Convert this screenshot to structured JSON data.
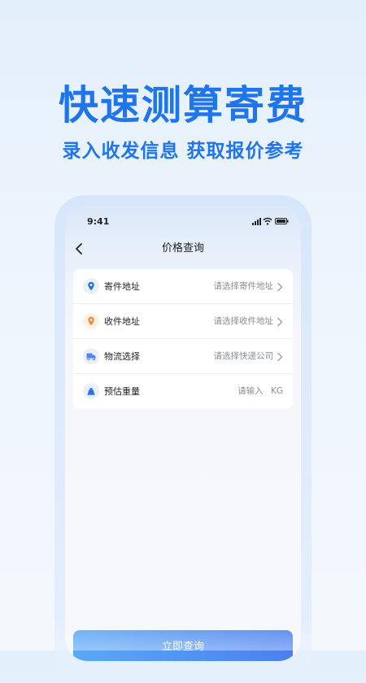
{
  "hero": {
    "title": "快速测算寄费",
    "subtitle": "录入收发信息 获取报价参考"
  },
  "status_bar": {
    "time": "9:41",
    "icons": [
      "signal-icon",
      "wifi-icon",
      "battery-icon"
    ]
  },
  "nav": {
    "back_icon": "chevron-left-icon",
    "title": "价格查询"
  },
  "form": {
    "rows": [
      {
        "icon": "location-pin-icon",
        "icon_color": "#1f6fe6",
        "label": "寄件地址",
        "value": "请选择寄件地址",
        "has_arrow": true
      },
      {
        "icon": "location-pin-icon",
        "icon_color": "#f2892c",
        "label": "收件地址",
        "value": "请选择收件地址",
        "has_arrow": true
      },
      {
        "icon": "truck-icon",
        "icon_color": "#4f86f0",
        "label": "物流选择",
        "value": "请选择快递公司",
        "has_arrow": true
      },
      {
        "icon": "weight-bag-icon",
        "icon_color": "#2f6fe8",
        "label": "预估重量",
        "value": "请输入",
        "unit": "KG",
        "has_arrow": false
      }
    ]
  },
  "submit": {
    "label": "立即查询"
  },
  "colors": {
    "brand": "#1f76ec",
    "button_start": "#5ba8f5",
    "button_end": "#4c7ff0"
  }
}
